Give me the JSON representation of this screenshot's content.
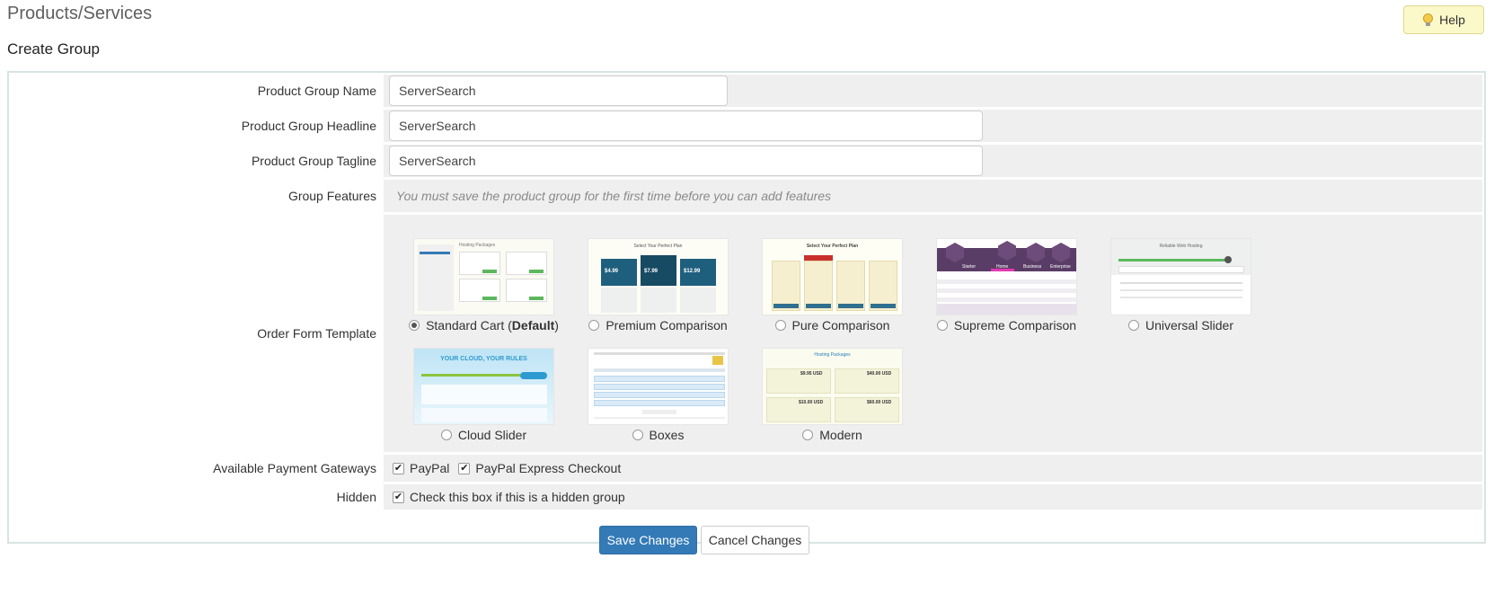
{
  "header": {
    "title": "Products/Services",
    "help_label": "Help",
    "subtitle": "Create Group"
  },
  "form": {
    "group_name": {
      "label": "Product Group Name",
      "value": "ServerSearch"
    },
    "group_headline": {
      "label": "Product Group Headline",
      "value": "ServerSearch"
    },
    "group_tagline": {
      "label": "Product Group Tagline",
      "value": "ServerSearch"
    },
    "group_features": {
      "label": "Group Features",
      "note": "You must save the product group for the first time before you can add features"
    },
    "order_form_template": {
      "label": "Order Form Template",
      "selected": "Standard Cart",
      "default_suffix": "Default",
      "templates": [
        {
          "name": "Standard Cart",
          "thumb_heading": "Hosting Packages",
          "selected": true
        },
        {
          "name": "Premium Comparison",
          "thumb_heading": "Select Your Perfect Plan",
          "prices": [
            "$4.99",
            "$7.99",
            "$12.99"
          ],
          "selected": false
        },
        {
          "name": "Pure Comparison",
          "thumb_heading": "Select Your Perfect Plan",
          "selected": false
        },
        {
          "name": "Supreme Comparison",
          "thumb_labels": [
            "Starter",
            "Home",
            "Business",
            "Enterprise"
          ],
          "selected": false
        },
        {
          "name": "Universal Slider",
          "thumb_heading": "Reliable Web Hosting",
          "selected": false
        },
        {
          "name": "Cloud Slider",
          "thumb_heading": "YOUR CLOUD, YOUR RULES",
          "selected": false
        },
        {
          "name": "Boxes",
          "selected": false
        },
        {
          "name": "Modern",
          "thumb_heading": "Hosting Packages",
          "prices": [
            "$9.95 USD",
            "$40.00 USD",
            "$10.00 USD",
            "$60.00 USD"
          ],
          "selected": false
        }
      ]
    },
    "payment_gateways": {
      "label": "Available Payment Gateways",
      "options": [
        {
          "name": "PayPal",
          "checked": true
        },
        {
          "name": "PayPal Express Checkout",
          "checked": true
        }
      ]
    },
    "hidden": {
      "label": "Hidden",
      "text": "Check this box if this is a hidden group",
      "checked": true
    }
  },
  "actions": {
    "save_label": "Save Changes",
    "cancel_label": "Cancel Changes"
  },
  "colors": {
    "primary": "#337ab7",
    "help_bg": "#fbf9c9",
    "row_bg": "#efefef",
    "border": "#d8e4e3"
  },
  "icons": {
    "help": "lightbulb-icon",
    "check": "checkmark-icon"
  }
}
